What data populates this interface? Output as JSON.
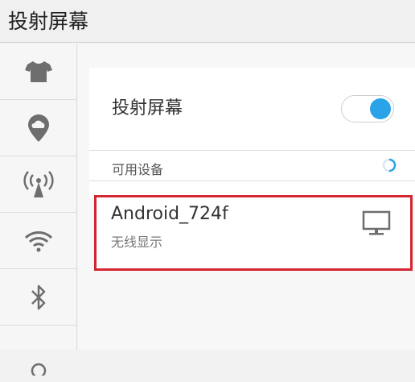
{
  "header": {
    "title": "投射屏幕"
  },
  "sidebar": {
    "items": [
      {
        "icon": "tshirt-icon"
      },
      {
        "icon": "cloud-location-icon"
      },
      {
        "icon": "hotspot-icon"
      },
      {
        "icon": "wifi-icon"
      },
      {
        "icon": "bluetooth-icon"
      },
      {
        "icon": "more-icon"
      }
    ]
  },
  "cast": {
    "label": "投射屏幕",
    "enabled": true,
    "toggle_color": "#2aa3e8"
  },
  "devices_section": {
    "label": "可用设备",
    "scanning": true
  },
  "devices": [
    {
      "name": "Android_724f",
      "status": "无线显示",
      "icon": "monitor-icon"
    }
  ],
  "highlight_color": "#d32630"
}
